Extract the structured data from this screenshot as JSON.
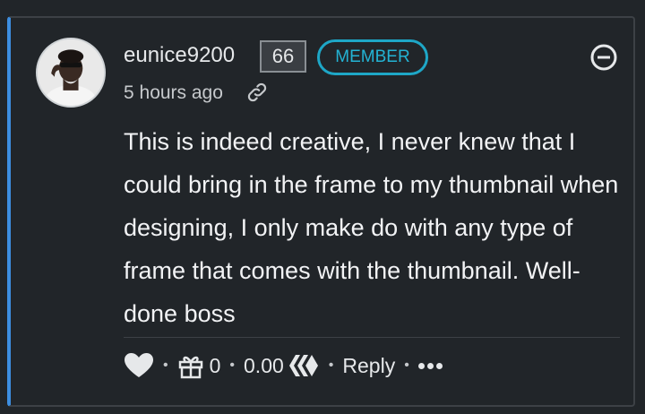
{
  "comment": {
    "username": "eunice9200",
    "reputation": "66",
    "badge": "MEMBER",
    "time": "5 hours ago",
    "body": "This is indeed creative, I never knew that I could bring in the frame to my thumbnail when designing, I only make do with any type of frame that comes with the thumbnail. Well-done boss"
  },
  "footer": {
    "separator": "•",
    "gift_count": "0",
    "payout": "0.00",
    "reply_label": "Reply"
  },
  "icons": [
    "avatar",
    "collapse-icon",
    "link-icon",
    "heart-icon",
    "gift-icon",
    "hive-icon",
    "more-icon"
  ],
  "colors": {
    "accent": "#3d8ee0",
    "badge": "#23b3d4",
    "background": "#212529"
  }
}
